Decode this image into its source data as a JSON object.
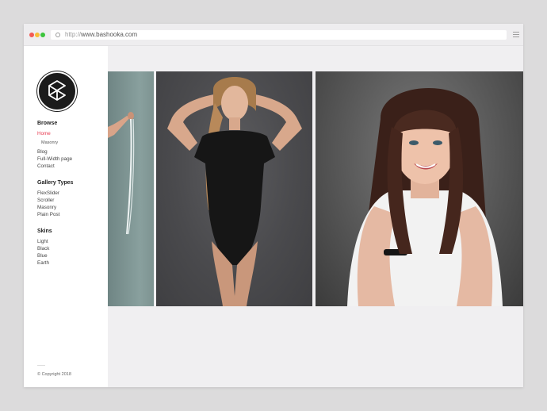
{
  "browser": {
    "url_prefix": "http://",
    "url_domain": "www.bashooka.com"
  },
  "sidebar": {
    "browse": {
      "heading": "Browse",
      "items": [
        "Home",
        "Masonry",
        "Blog",
        "Full-Width page",
        "Contact"
      ]
    },
    "gallery_types": {
      "heading": "Gallery Types",
      "items": [
        "FlexSlider",
        "Scroller",
        "Masonry",
        "Plain Post"
      ]
    },
    "skins": {
      "heading": "Skins",
      "items": [
        "Light",
        "Black",
        "Blue",
        "Earth"
      ]
    },
    "copyright": "© Copyright 2018"
  },
  "colors": {
    "accent": "#e8394f",
    "logo_bg": "#1b1b1b"
  },
  "gallery": {
    "photos": [
      "photo-woman-teal-background-partial",
      "photo-woman-black-bodysuit",
      "photo-woman-brunette-bangs-smiling"
    ]
  }
}
